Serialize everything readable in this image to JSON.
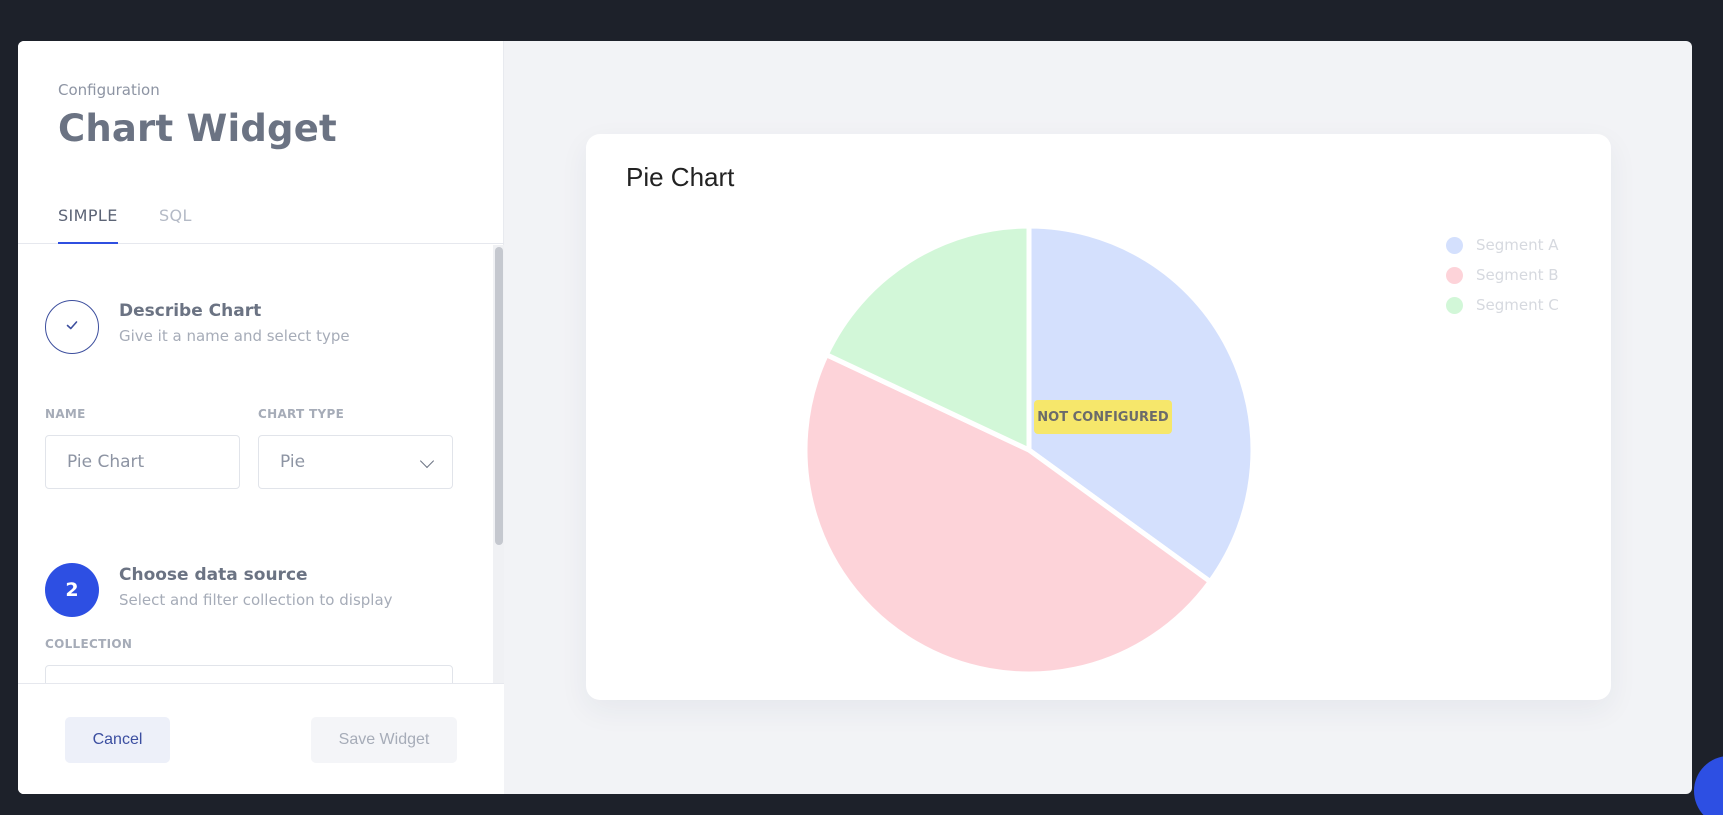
{
  "left_panel": {
    "eyebrow": "Configuration",
    "title": "Chart Widget",
    "tabs": [
      {
        "label": "SIMPLE"
      },
      {
        "label": "SQL"
      }
    ]
  },
  "steps": [
    {
      "title": "Describe Chart",
      "subtitle": "Give it a name and select type",
      "status": "completed"
    },
    {
      "number": "2",
      "title": "Choose data source",
      "subtitle": "Select and filter collection to display"
    }
  ],
  "fields": {
    "name_label": "NAME",
    "name_value": "Pie Chart",
    "chart_type_label": "CHART TYPE",
    "chart_type_value": "Pie",
    "collection_label": "COLLECTION"
  },
  "footer": {
    "cancel_label": "Cancel",
    "save_label": "Save Widget"
  },
  "preview": {
    "title": "Pie Chart",
    "badge": "NOT CONFIGURED"
  },
  "colors": {
    "accent": "#2d4fe3",
    "segment_a": "#d4e0fd",
    "segment_b": "#fdd3d9",
    "segment_c": "#d2f7d8",
    "badge": "#f6e76b"
  },
  "chart_data": {
    "type": "pie",
    "title": "Pie Chart",
    "categories": [
      "Segment A",
      "Segment B",
      "Segment C"
    ],
    "values": [
      35,
      47,
      18
    ],
    "legend": "top-right"
  }
}
